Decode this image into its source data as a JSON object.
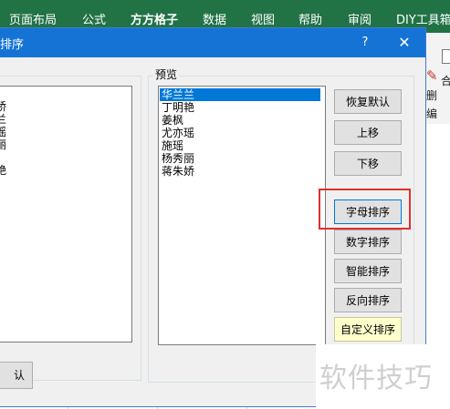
{
  "ribbon": {
    "tabs": [
      "页面布局",
      "公式",
      "方方格子",
      "数据",
      "视图",
      "帮助",
      "审阅",
      "DIY工具箱"
    ],
    "side_labels": [
      "删",
      "合",
      "编"
    ]
  },
  "dialog": {
    "title": "排序",
    "help": "?",
    "close": "✕",
    "left_list": [
      "娇",
      "兰",
      "瑶",
      "丽",
      "艳"
    ],
    "preview_label": "预览",
    "preview_items": [
      "华兰兰",
      "丁明艳",
      "姜枫",
      "尤亦瑶",
      "施瑶",
      "杨秀丽",
      "蒋朱娇"
    ],
    "selected_index": 0,
    "buttons": {
      "restore_default": "恢复默认",
      "move_up": "上移",
      "move_down": "下移",
      "alpha_sort": "字母排序",
      "numeric_sort": "数字排序",
      "smart_sort": "智能排序",
      "reverse_sort": "反向排序",
      "custom_sort": "自定义排序"
    },
    "ok_partial": "认"
  },
  "watermark": "软件技巧",
  "colors": {
    "excel_green": "#217346",
    "dialog_title": "#1673d6",
    "highlight": "#e0302b",
    "selection": "#0078d7"
  }
}
